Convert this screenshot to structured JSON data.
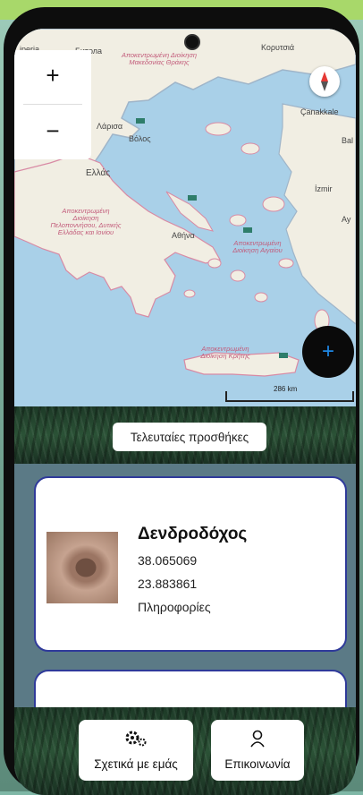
{
  "map": {
    "zoom_in": "+",
    "zoom_out": "−",
    "scale_text": "286 km",
    "fab_label": "+",
    "labels": {
      "iperia": "iperia",
      "bitola": "Битола",
      "koryazi": "Κορυτσιά",
      "larisa": "Λάρισα",
      "volos": "Βόλος",
      "ellada": "Ελλάς",
      "athina": "Αθήνα",
      "canakkale": "Çanakkale",
      "izmir": "İzmir",
      "ay": "Ay",
      "bal": "Bal"
    },
    "regions": {
      "makedonia": "Αποκεντρωμένη Διοίκηση Μακεδονίας Θράκης",
      "peloponnisos": "Αποκεντρωμένη Διοίκηση Πελοποννήσου, Δυτικής Ελλάδας και Ιονίου",
      "aigaio": "Αποκεντρωμένη Διοίκηση Αιγαίου",
      "kriti": "Αποκεντρωμένη Διοίκηση Κρήτης"
    }
  },
  "banner": {
    "recent_label": "Τελευταίες προσθήκες"
  },
  "cards": [
    {
      "title": "Δενδροδόχος",
      "lat": "38.065069",
      "lon": "23.883861",
      "info": "Πληροφορίες"
    }
  ],
  "bottom": {
    "about_label": "Σχετικά με εμάς",
    "contact_label": "Επικοινωνία"
  },
  "icons": [
    "gears-icon",
    "person-icon",
    "compass-icon",
    "plus-icon",
    "map-pin-icon"
  ]
}
